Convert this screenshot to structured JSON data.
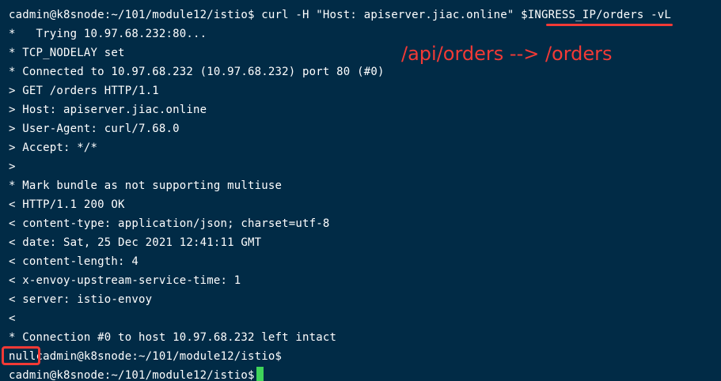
{
  "terminal": {
    "lines": [
      "cadmin@k8snode:~/101/module12/istio$ curl -H \"Host: apiserver.jiac.online\" $INGRESS_IP/orders -vL",
      "*   Trying 10.97.68.232:80...",
      "* TCP_NODELAY set",
      "* Connected to 10.97.68.232 (10.97.68.232) port 80 (#0)",
      "> GET /orders HTTP/1.1",
      "> Host: apiserver.jiac.online",
      "> User-Agent: curl/7.68.0",
      "> Accept: */*",
      ">",
      "* Mark bundle as not supporting multiuse",
      "< HTTP/1.1 200 OK",
      "< content-type: application/json; charset=utf-8",
      "< date: Sat, 25 Dec 2021 12:41:11 GMT",
      "< content-length: 4",
      "< x-envoy-upstream-service-time: 1",
      "< server: istio-envoy",
      "<",
      "* Connection #0 to host 10.97.68.232 left intact",
      "nullcadmin@k8snode:~/101/module12/istio$",
      "cadmin@k8snode:~/101/module12/istio$"
    ]
  },
  "annotation": {
    "text": "/api/orders --> /orders"
  },
  "colors": {
    "background": "#012b46",
    "foreground": "#ffffff",
    "annotation": "#f23a36",
    "cursor": "#3fd45a"
  }
}
